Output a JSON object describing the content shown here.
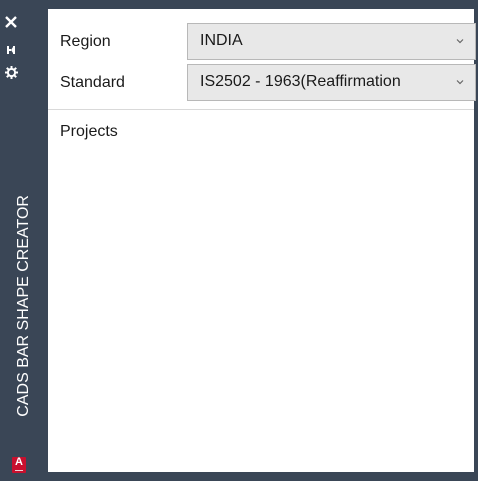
{
  "sidebar": {
    "title": "CADS BAR SHAPE CREATOR",
    "icons": [
      "close-icon",
      "pin-icon",
      "gear-icon"
    ],
    "logo_letter": "A"
  },
  "form": {
    "region_label": "Region",
    "region_value": "INDIA",
    "standard_label": "Standard",
    "standard_value": "IS2502 - 1963(Reaffirmation",
    "projects_label": "Projects"
  },
  "colors": {
    "sidebar": "#3a4656",
    "combo_bg": "#e8e8e8",
    "logo": "#c8102e"
  }
}
